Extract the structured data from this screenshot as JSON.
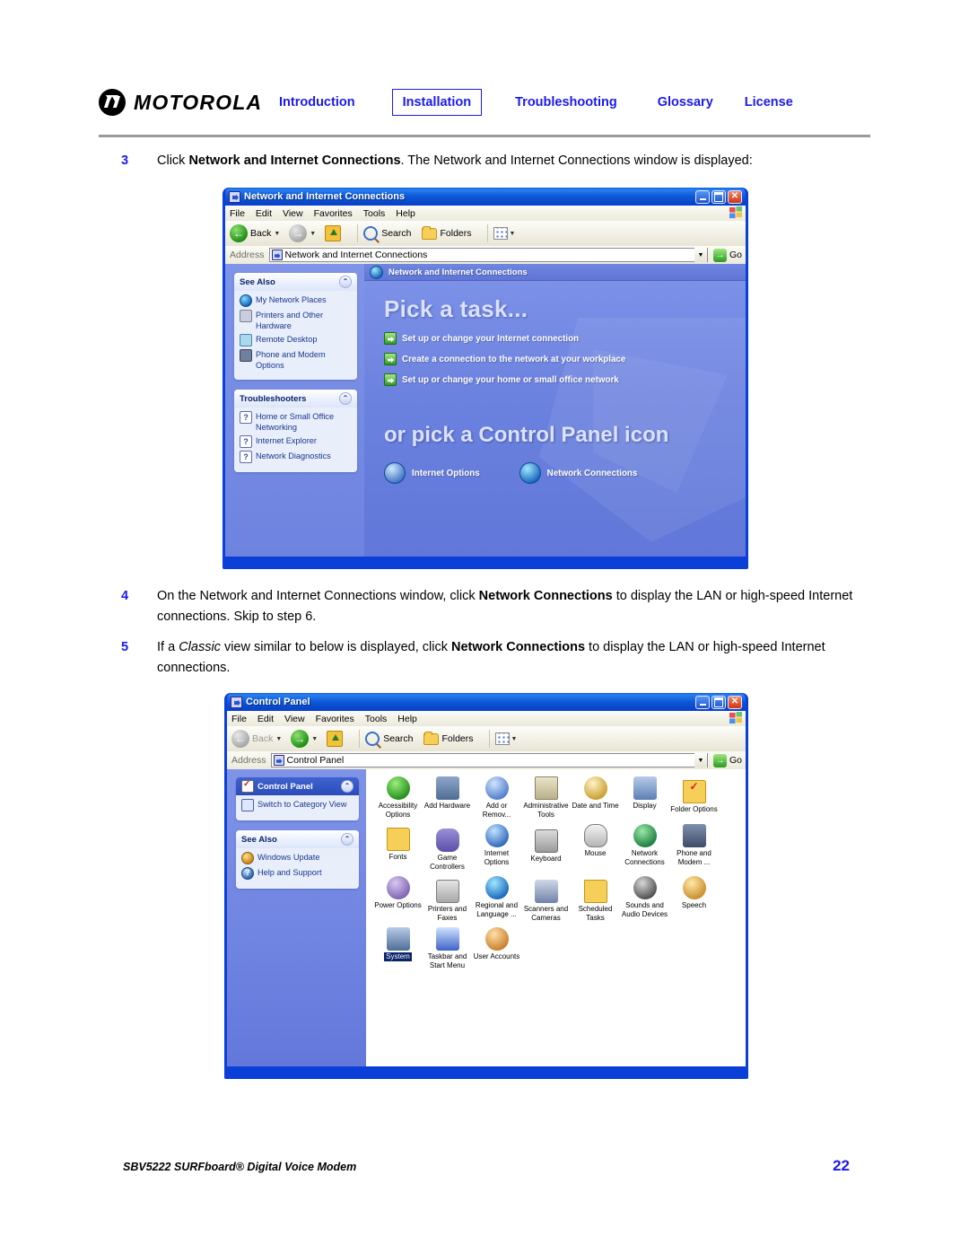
{
  "header": {
    "brand": "MOTOROLA",
    "nav": [
      {
        "label": "Introduction",
        "active": false
      },
      {
        "label": "Installation",
        "active": true
      },
      {
        "label": "Troubleshooting",
        "active": false
      },
      {
        "label": "Glossary",
        "active": false
      },
      {
        "label": "License",
        "active": false
      }
    ]
  },
  "steps": {
    "step3": {
      "num": "3",
      "text_before": "Click ",
      "bold1": "Network and Internet Connections",
      "text_after": ". The Network and Internet Connections window is displayed:"
    },
    "step4": {
      "num": "4",
      "text_before": "On the Network and Internet Connections window, click ",
      "bold1": "Network Connections",
      "text_after": " to display the LAN or high-speed Internet connections. Skip to step 6."
    },
    "step5": {
      "num": "5",
      "text_before": "If a ",
      "italic1": "Classic",
      "text_mid": " view similar to below is displayed, click ",
      "bold1": "Network Connections",
      "text_after": " to display the LAN or high-speed Internet connections."
    }
  },
  "window1": {
    "title": "Network and Internet Connections",
    "title_icon": "network-folder-icon",
    "buttons": {
      "minimize": "minimize-button",
      "maximize": "maximize-button",
      "close": "close-button"
    },
    "menu": [
      "File",
      "Edit",
      "View",
      "Favorites",
      "Tools",
      "Help"
    ],
    "toolbar": {
      "back": "Back",
      "forward": "",
      "up": "",
      "search": "Search",
      "folders": "Folders",
      "views": "views-button"
    },
    "address": {
      "label": "Address",
      "value": "Network and Internet Connections",
      "go": "Go"
    },
    "taskpane": [
      {
        "title": "See Also",
        "items": [
          {
            "label": "My Network Places",
            "icon": "globe-icon"
          },
          {
            "label": "Printers and Other Hardware",
            "icon": "printer-icon"
          },
          {
            "label": "Remote Desktop",
            "icon": "remote-desktop-icon"
          },
          {
            "label": "Phone and Modem Options",
            "icon": "modem-icon"
          }
        ]
      },
      {
        "title": "Troubleshooters",
        "items": [
          {
            "label": "Home or Small Office Networking",
            "icon": "question-icon"
          },
          {
            "label": "Internet Explorer",
            "icon": "question-icon"
          },
          {
            "label": "Network Diagnostics",
            "icon": "question-icon"
          }
        ]
      }
    ],
    "banner": "Network and Internet Connections",
    "heading1": "Pick a task...",
    "tasks": [
      "Set up or change your Internet connection",
      "Create a connection to the network at your workplace",
      "Set up or change your home or small office network"
    ],
    "heading2": "or pick a Control Panel icon",
    "cpicons": [
      {
        "label": "Internet Options",
        "icon": "internet-options-icon"
      },
      {
        "label": "Network Connections",
        "icon": "network-connections-icon"
      }
    ]
  },
  "window2": {
    "title": "Control Panel",
    "title_icon": "control-panel-icon",
    "menu": [
      "File",
      "Edit",
      "View",
      "Favorites",
      "Tools",
      "Help"
    ],
    "toolbar": {
      "back": "Back",
      "search": "Search",
      "folders": "Folders",
      "views": "views-button"
    },
    "address": {
      "label": "Address",
      "value": "Control Panel",
      "go": "Go"
    },
    "taskpane": [
      {
        "title": "Control Panel",
        "selected": true,
        "items": [
          {
            "label": "Switch to Category View",
            "icon": "switch-view-icon"
          }
        ]
      },
      {
        "title": "See Also",
        "selected": false,
        "items": [
          {
            "label": "Windows Update",
            "icon": "windows-update-icon"
          },
          {
            "label": "Help and Support",
            "icon": "help-support-icon"
          }
        ]
      }
    ],
    "icons": [
      {
        "label": "Accessibility Options",
        "icon": "accessibility-icon",
        "shape": "gi-access",
        "selected": false
      },
      {
        "label": "Add Hardware",
        "icon": "add-hardware-icon",
        "shape": "gi-addhw",
        "selected": false
      },
      {
        "label": "Add or Remov...",
        "icon": "add-remove-programs-icon",
        "shape": "gi-addrm",
        "selected": false
      },
      {
        "label": "Administrative Tools",
        "icon": "administrative-tools-icon",
        "shape": "gi-admin",
        "selected": false
      },
      {
        "label": "Date and Time",
        "icon": "date-time-icon",
        "shape": "gi-date",
        "selected": false
      },
      {
        "label": "Display",
        "icon": "display-icon",
        "shape": "gi-disp",
        "selected": false
      },
      {
        "label": "Folder Options",
        "icon": "folder-options-icon",
        "shape": "gi-folder",
        "selected": false
      },
      {
        "label": "Fonts",
        "icon": "fonts-icon",
        "shape": "gi-fonts",
        "selected": false
      },
      {
        "label": "Game Controllers",
        "icon": "game-controllers-icon",
        "shape": "gi-game",
        "selected": false
      },
      {
        "label": "Internet Options",
        "icon": "internet-options-icon",
        "shape": "gi-ie",
        "selected": false
      },
      {
        "label": "Keyboard",
        "icon": "keyboard-icon",
        "shape": "gi-kbd",
        "selected": false
      },
      {
        "label": "Mouse",
        "icon": "mouse-icon",
        "shape": "gi-mouse",
        "selected": false
      },
      {
        "label": "Network Connections",
        "icon": "network-connections-icon",
        "shape": "gi-net",
        "selected": false
      },
      {
        "label": "Phone and Modem ...",
        "icon": "phone-modem-icon",
        "shape": "gi-phone",
        "selected": false
      },
      {
        "label": "Power Options",
        "icon": "power-options-icon",
        "shape": "gi-power",
        "selected": false
      },
      {
        "label": "Printers and Faxes",
        "icon": "printers-faxes-icon",
        "shape": "gi-print",
        "selected": false
      },
      {
        "label": "Regional and Language ...",
        "icon": "regional-language-icon",
        "shape": "gi-region",
        "selected": false
      },
      {
        "label": "Scanners and Cameras",
        "icon": "scanners-cameras-icon",
        "shape": "gi-scan",
        "selected": false
      },
      {
        "label": "Scheduled Tasks",
        "icon": "scheduled-tasks-icon",
        "shape": "gi-sched",
        "selected": false
      },
      {
        "label": "Sounds and Audio Devices",
        "icon": "sounds-audio-icon",
        "shape": "gi-sound",
        "selected": false
      },
      {
        "label": "Speech",
        "icon": "speech-icon",
        "shape": "gi-speech",
        "selected": false
      },
      {
        "label": "System",
        "icon": "system-icon",
        "shape": "gi-system",
        "selected": true
      },
      {
        "label": "Taskbar and Start Menu",
        "icon": "taskbar-start-menu-icon",
        "shape": "gi-taskbar",
        "selected": false
      },
      {
        "label": "User Accounts",
        "icon": "user-accounts-icon",
        "shape": "gi-users",
        "selected": false
      }
    ]
  },
  "footer": {
    "text": "SBV5222 SURFboard® Digital Voice Modem",
    "page": "22"
  },
  "colors": {
    "link_blue": "#1a1aee",
    "xp_title_blue": "#0a3fd8",
    "task_pane_blue": "#7287e2",
    "rule_grey": "#9a9a9a"
  }
}
